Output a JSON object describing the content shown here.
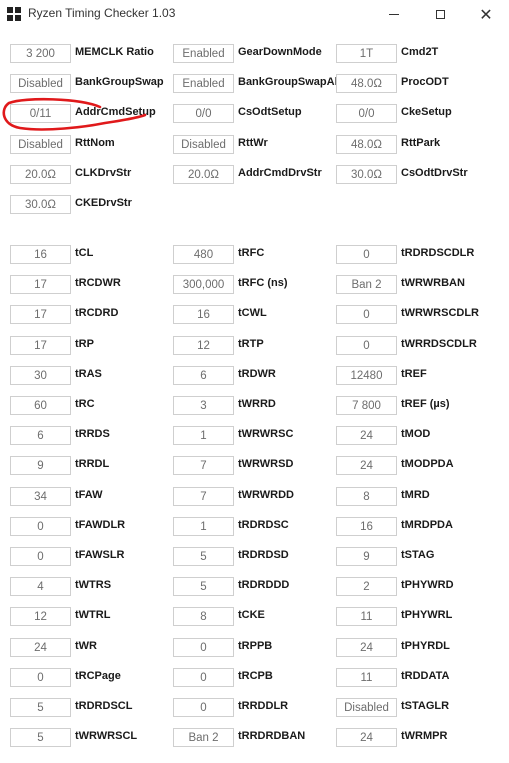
{
  "window": {
    "title": "Ryzen Timing Checker 1.03",
    "close_glyph": "✕"
  },
  "annotation_color": "#e0191b",
  "settings": [
    [
      {
        "value": "3 200",
        "label": "MEMCLK Ratio"
      },
      {
        "value": "Enabled",
        "label": "GearDownMode"
      },
      {
        "value": "1T",
        "label": "Cmd2T"
      }
    ],
    [
      {
        "value": "Disabled",
        "label": "BankGroupSwap"
      },
      {
        "value": "Enabled",
        "label": "BankGroupSwapAlt"
      },
      {
        "value": "48.0Ω",
        "label": "ProcODT"
      }
    ],
    [
      {
        "value": "0/11",
        "label": "AddrCmdSetup"
      },
      {
        "value": "0/0",
        "label": "CsOdtSetup"
      },
      {
        "value": "0/0",
        "label": "CkeSetup"
      }
    ],
    [
      {
        "value": "Disabled",
        "label": "RttNom"
      },
      {
        "value": "Disabled",
        "label": "RttWr"
      },
      {
        "value": "48.0Ω",
        "label": "RttPark"
      }
    ],
    [
      {
        "value": "20.0Ω",
        "label": "CLKDrvStr"
      },
      {
        "value": "20.0Ω",
        "label": "AddrCmdDrvStr"
      },
      {
        "value": "30.0Ω",
        "label": "CsOdtDrvStr"
      }
    ],
    [
      {
        "value": "30.0Ω",
        "label": "CKEDrvStr"
      }
    ]
  ],
  "timings": [
    [
      {
        "value": "16",
        "label": "tCL"
      },
      {
        "value": "480",
        "label": "tRFC"
      },
      {
        "value": "0",
        "label": "tRDRDSCDLR"
      }
    ],
    [
      {
        "value": "17",
        "label": "tRCDWR"
      },
      {
        "value": "300,000",
        "label": "tRFC (ns)"
      },
      {
        "value": "Ban 2",
        "label": "tWRWRBAN"
      }
    ],
    [
      {
        "value": "17",
        "label": "tRCDRD"
      },
      {
        "value": "16",
        "label": "tCWL"
      },
      {
        "value": "0",
        "label": "tWRWRSCDLR"
      }
    ],
    [
      {
        "value": "17",
        "label": "tRP"
      },
      {
        "value": "12",
        "label": "tRTP"
      },
      {
        "value": "0",
        "label": "tWRRDSCDLR"
      }
    ],
    [
      {
        "value": "30",
        "label": "tRAS"
      },
      {
        "value": "6",
        "label": "tRDWR"
      },
      {
        "value": "12480",
        "label": "tREF"
      }
    ],
    [
      {
        "value": "60",
        "label": "tRC"
      },
      {
        "value": "3",
        "label": "tWRRD"
      },
      {
        "value": "7 800",
        "label": "tREF (µs)"
      }
    ],
    [
      {
        "value": "6",
        "label": "tRRDS"
      },
      {
        "value": "1",
        "label": "tWRWRSC"
      },
      {
        "value": "24",
        "label": "tMOD"
      }
    ],
    [
      {
        "value": "9",
        "label": "tRRDL"
      },
      {
        "value": "7",
        "label": "tWRWRSD"
      },
      {
        "value": "24",
        "label": "tMODPDA"
      }
    ],
    [
      {
        "value": "34",
        "label": "tFAW"
      },
      {
        "value": "7",
        "label": "tWRWRDD"
      },
      {
        "value": "8",
        "label": "tMRD"
      }
    ],
    [
      {
        "value": "0",
        "label": "tFAWDLR"
      },
      {
        "value": "1",
        "label": "tRDRDSC"
      },
      {
        "value": "16",
        "label": "tMRDPDA"
      }
    ],
    [
      {
        "value": "0",
        "label": "tFAWSLR"
      },
      {
        "value": "5",
        "label": "tRDRDSD"
      },
      {
        "value": "9",
        "label": "tSTAG"
      }
    ],
    [
      {
        "value": "4",
        "label": "tWTRS"
      },
      {
        "value": "5",
        "label": "tRDRDDD"
      },
      {
        "value": "2",
        "label": "tPHYWRD"
      }
    ],
    [
      {
        "value": "12",
        "label": "tWTRL"
      },
      {
        "value": "8",
        "label": "tCKE"
      },
      {
        "value": "11",
        "label": "tPHYWRL"
      }
    ],
    [
      {
        "value": "24",
        "label": "tWR"
      },
      {
        "value": "0",
        "label": "tRPPB"
      },
      {
        "value": "24",
        "label": "tPHYRDL"
      }
    ],
    [
      {
        "value": "0",
        "label": "tRCPage"
      },
      {
        "value": "0",
        "label": "tRCPB"
      },
      {
        "value": "11",
        "label": "tRDDATA"
      }
    ],
    [
      {
        "value": "5",
        "label": "tRDRDSCL"
      },
      {
        "value": "0",
        "label": "tRRDDLR"
      },
      {
        "value": "Disabled",
        "label": "tSTAGLR"
      }
    ],
    [
      {
        "value": "5",
        "label": "tWRWRSCL"
      },
      {
        "value": "Ban 2",
        "label": "tRRDRDBAN"
      },
      {
        "value": "24",
        "label": "tWRMPR"
      }
    ]
  ]
}
